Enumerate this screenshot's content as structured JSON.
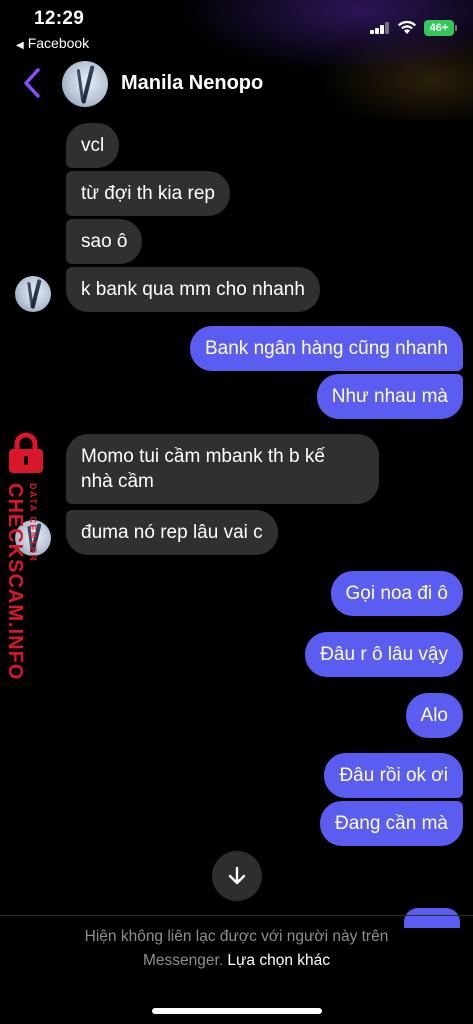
{
  "status_bar": {
    "time": "12:29",
    "back_app": "Facebook",
    "battery": "46+"
  },
  "header": {
    "contact_name": "Manila Nenopo"
  },
  "messages": [
    {
      "text": "vcl",
      "direction": "incoming"
    },
    {
      "text": "từ đợi th kia rep",
      "direction": "incoming"
    },
    {
      "text": "sao ô",
      "direction": "incoming"
    },
    {
      "text": "k bank qua mm cho nhanh",
      "direction": "incoming"
    },
    {
      "text": "Bank ngân hàng cũng nhanh",
      "direction": "outgoing"
    },
    {
      "text": "Như nhau mà",
      "direction": "outgoing"
    },
    {
      "text": "Momo tui cầm mbank th b kế",
      "text2": "nhà cầm",
      "direction": "incoming"
    },
    {
      "text": "đuma nó rep lâu vai c",
      "direction": "incoming"
    },
    {
      "text": "Gọi noa đi ô",
      "direction": "outgoing"
    },
    {
      "text": "Đâu r ô lâu vậy",
      "direction": "outgoing"
    },
    {
      "text": "Alo",
      "direction": "outgoing"
    },
    {
      "text": "Đâu rồi ok ơi",
      "direction": "outgoing"
    },
    {
      "text": "Đang cần mà",
      "direction": "outgoing"
    }
  ],
  "watermark": {
    "main": "CHECKSCAM.INFO",
    "small": "DATA CENTER"
  },
  "footer": {
    "notice_line1": "Hiện không liên lạc được với người này trên",
    "notice_line2": "Messenger.",
    "link": "Lựa chọn khác"
  },
  "icons": [
    "back-chevron-icon",
    "scroll-down-arrow-icon",
    "signal-icon",
    "wifi-icon",
    "battery-icon",
    "lock-icon"
  ],
  "colors": {
    "outgoing_bubble": "#5b5df0",
    "incoming_bubble": "#303030",
    "accent": "#8a4dff",
    "watermark": "#d8182a"
  }
}
